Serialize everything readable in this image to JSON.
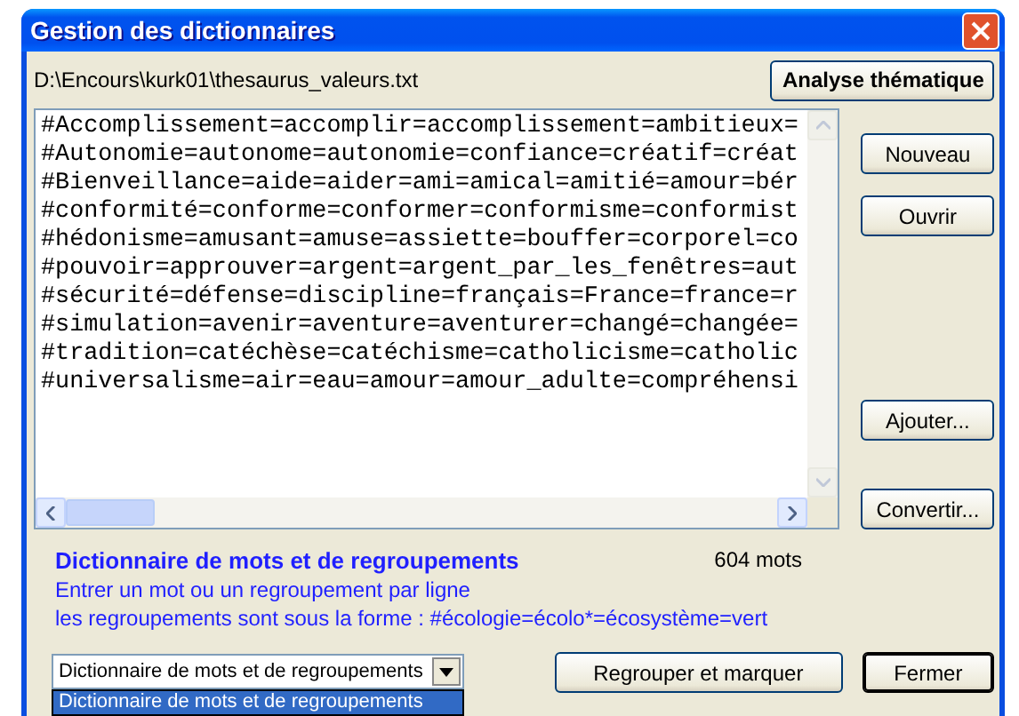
{
  "window": {
    "title": "Gestion des dictionnaires"
  },
  "file_path": "D:\\Encours\\kurk01\\thesaurus_valeurs.txt",
  "analyse_button": "Analyse thématique",
  "editor": {
    "lines": [
      "#Accomplissement=accomplir=accomplissement=ambitieux=",
      "#Autonomie=autonome=autonomie=confiance=créatif=créat",
      "#Bienveillance=aide=aider=ami=amical=amitié=amour=bér",
      "#conformité=conforme=conformer=conformisme=conformist",
      "#hédonisme=amusant=amuse=assiette=bouffer=corporel=co",
      "#pouvoir=approuver=argent=argent_par_les_fenêtres=aut",
      "#sécurité=défense=discipline=français=France=france=r",
      "#simulation=avenir=aventure=aventurer=changé=changée=",
      "#tradition=catéchèse=catéchisme=catholicisme=catholic",
      "#universalisme=air=eau=amour=amour_adulte=compréhensi"
    ]
  },
  "top_buttons": [
    {
      "label": "Nouveau"
    },
    {
      "label": "Ouvrir"
    }
  ],
  "bottom_buttons": [
    {
      "label": "Ajouter..."
    },
    {
      "label": "Convertir..."
    }
  ],
  "dictionary": {
    "title": "Dictionnaire de mots et de regroupements",
    "count": "604 mots",
    "hint_lines": [
      "Entrer un mot ou un regroupement par ligne",
      "les regroupements sont sous la forme : #écologie=écolo*=écosystème=vert"
    ]
  },
  "type_select": {
    "value": "Dictionnaire de mots et de regroupements",
    "options": [
      {
        "label": "Dictionnaire de mots et de regroupements",
        "selected": true
      }
    ]
  },
  "buttons": [
    {
      "label": "Regrouper et marquer",
      "default": false
    },
    {
      "label": "Fermer",
      "default": true
    }
  ]
}
